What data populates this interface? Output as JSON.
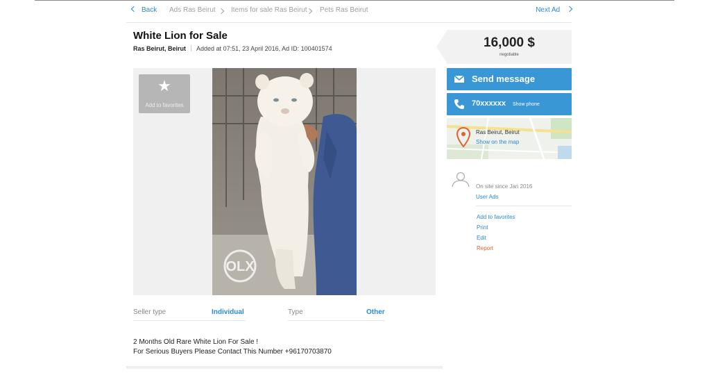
{
  "breadcrumb": {
    "back_label": "Back",
    "items": [
      "Ads Ras Beirut",
      "Items for sale Ras Beirut",
      "Pets Ras Beirut"
    ],
    "next_label": "Next Ad"
  },
  "ad": {
    "title": "White Lion for Sale",
    "location": "Ras Beirut, Beirut",
    "added_info": "Added at 07:51, 23 April 2016, Ad ID: 100401574",
    "price": "16,000 $",
    "price_note": "negotiable",
    "photo_watermark": "OLX"
  },
  "gallery": {
    "favorite_label": "Add to favorites"
  },
  "contact": {
    "send_message_label": "Send message",
    "phone_masked": "70xxxxxx",
    "show_phone_label": "Show phone"
  },
  "map": {
    "location": "Ras Beirut, Beirut",
    "show_on_map_label": "Show on the map"
  },
  "seller": {
    "since": "On site since Jan 2016",
    "user_ads_label": "User Ads"
  },
  "actions": {
    "add_to_favorites": "Add to favorites",
    "print": "Print",
    "edit": "Edit",
    "report": "Report"
  },
  "details": [
    {
      "label": "Seller type",
      "value": "Individual"
    },
    {
      "label": "Type",
      "value": "Other"
    }
  ],
  "description": {
    "line1": "2 Months Old Rare White Lion For Sale !",
    "line2": "For Serious Buyers Please Contact This Number +96170703870"
  },
  "colors": {
    "accent": "#3a97d6",
    "link": "#2a8ad4",
    "report": "#e0622f"
  }
}
